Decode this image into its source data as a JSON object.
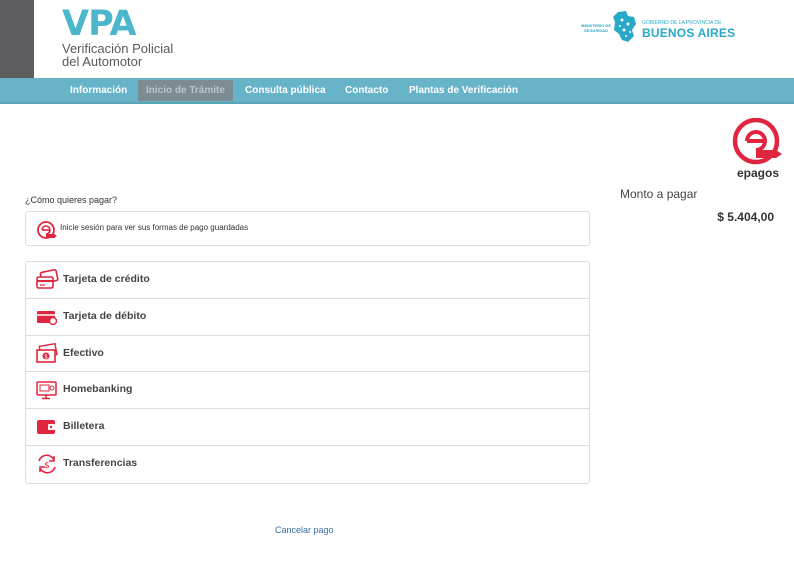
{
  "brand": {
    "name": "VPA",
    "line1": "Verificación Policial",
    "line2": "del Automotor"
  },
  "gov": {
    "ministry_line1": "MINISTERIO DE",
    "ministry_line2": "SEGURIDAD",
    "top": "GOBIERNO DE LA PROVINCIA DE",
    "name": "BUENOS AIRES"
  },
  "nav": [
    "Información",
    "Inicio de Trámite",
    "Consulta pública",
    "Contacto",
    "Plantas de Verificación"
  ],
  "nav_active": "Inicio de Trámite",
  "epagos": {
    "logo_text": "epagos"
  },
  "payment": {
    "question": "¿Cómo quieres pagar?",
    "login_text": "Inicie sesión para ver sus formas de pago guardadas",
    "methods": [
      {
        "label": "Tarjeta de crédito",
        "icon": "credit-card-icon"
      },
      {
        "label": "Tarjeta de débito",
        "icon": "debit-card-icon"
      },
      {
        "label": "Efectivo",
        "icon": "cash-icon"
      },
      {
        "label": "Homebanking",
        "icon": "homebanking-icon"
      },
      {
        "label": "Billetera",
        "icon": "wallet-icon"
      },
      {
        "label": "Transferencias",
        "icon": "transfer-icon"
      }
    ]
  },
  "summary": {
    "label": "Monto a pagar",
    "amount": "$ 5.404,00"
  },
  "cancel": "Cancelar pago",
  "colors": {
    "brand_teal": "#4bb6cc",
    "nav_bg": "#67b3c8",
    "epagos_red": "#e0253f"
  }
}
